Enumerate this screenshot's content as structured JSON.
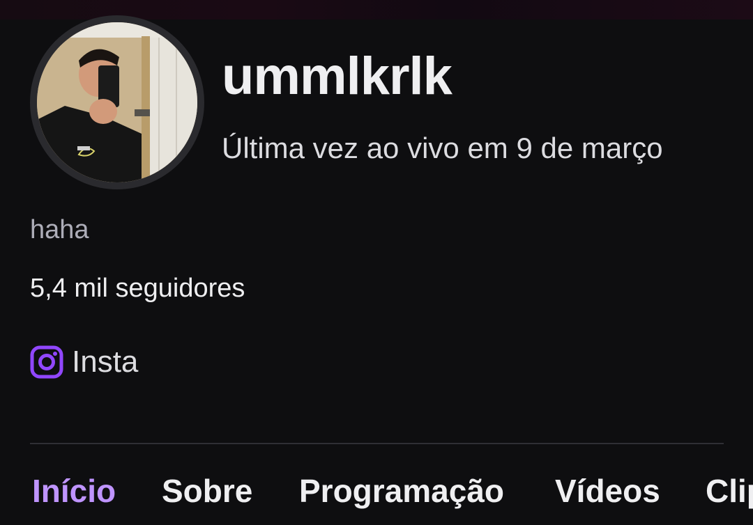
{
  "profile": {
    "username": "ummlkrlk",
    "last_live": "Última vez ao vivo em 9 de março",
    "bio": "haha",
    "followers": "5,4 mil seguidores",
    "avatar_icon": "profile-photo"
  },
  "links": [
    {
      "label": "Insta",
      "icon": "instagram-icon"
    }
  ],
  "tabs": [
    {
      "label": "Início",
      "active": true
    },
    {
      "label": "Sobre",
      "active": false
    },
    {
      "label": "Programação",
      "active": false
    },
    {
      "label": "Vídeos",
      "active": false
    },
    {
      "label": "Clipes",
      "active": false
    }
  ],
  "colors": {
    "background": "#0e0e10",
    "accent": "#bf94ff",
    "icon_accent": "#9147ff",
    "text_primary": "#efeff1",
    "text_muted": "#adadb8"
  }
}
